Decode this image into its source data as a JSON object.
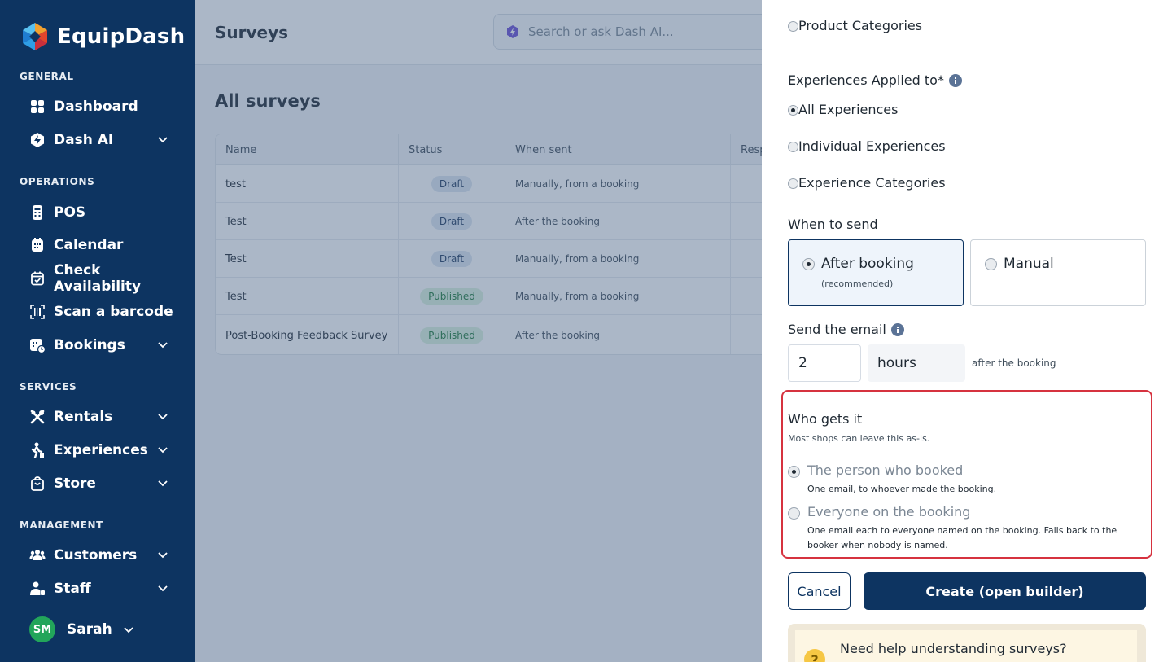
{
  "sidebar": {
    "brand": "EquipDash",
    "sections": {
      "general": "GENERAL",
      "operations": "OPERATIONS",
      "services": "SERVICES",
      "management": "MANAGEMENT"
    },
    "items": {
      "dashboard": "Dashboard",
      "dash_ai": "Dash AI",
      "pos": "POS",
      "calendar": "Calendar",
      "check_availability": "Check Availability",
      "scan_barcode": "Scan a barcode",
      "bookings": "Bookings",
      "rentals": "Rentals",
      "experiences": "Experiences",
      "store": "Store",
      "customers": "Customers",
      "staff": "Staff"
    },
    "user": {
      "initials": "SM",
      "name": "Sarah"
    }
  },
  "header": {
    "title": "Surveys",
    "search_placeholder": "Search or ask Dash AI..."
  },
  "main": {
    "title": "All surveys",
    "columns": [
      "Name",
      "Status",
      "When sent",
      "Resp"
    ],
    "rows": [
      {
        "name": "test",
        "status": "Draft",
        "when": "Manually, from a booking"
      },
      {
        "name": "Test",
        "status": "Draft",
        "when": "After the booking"
      },
      {
        "name": "Test",
        "status": "Draft",
        "when": "Manually, from a booking"
      },
      {
        "name": "Test",
        "status": "Published",
        "when": "Manually, from a booking"
      },
      {
        "name": "Post-Booking Feedback Survey",
        "status": "Published",
        "when": "After the booking"
      }
    ]
  },
  "drawer": {
    "product_categories": "Product Categories",
    "experiences_label": "Experiences Applied to*",
    "experience_options": [
      "All Experiences",
      "Individual Experiences",
      "Experience Categories"
    ],
    "when_label": "When to send",
    "when_options": [
      {
        "label": "After booking",
        "sub": "(recommended)"
      },
      {
        "label": "Manual",
        "sub": ""
      }
    ],
    "send_label": "Send the email",
    "send_value": "2",
    "send_unit": "hours",
    "send_suffix": "after the booking",
    "who_title": "Who gets it",
    "who_sub": "Most shops can leave this as-is.",
    "who_options": [
      {
        "label": "The person who booked",
        "desc": "One email, to whoever made the booking."
      },
      {
        "label": "Everyone on the booking",
        "desc": "One email each to everyone named on the booking. Falls back to the booker when nobody is named."
      }
    ],
    "cancel": "Cancel",
    "create": "Create (open builder)",
    "help": "Need help understanding surveys?"
  },
  "colors": {
    "sidebar": "#0d3461",
    "accent": "#0d3461",
    "highlight": "#d6323f",
    "draft_badge": "#dde6f1",
    "published_badge": "#daf2df"
  }
}
